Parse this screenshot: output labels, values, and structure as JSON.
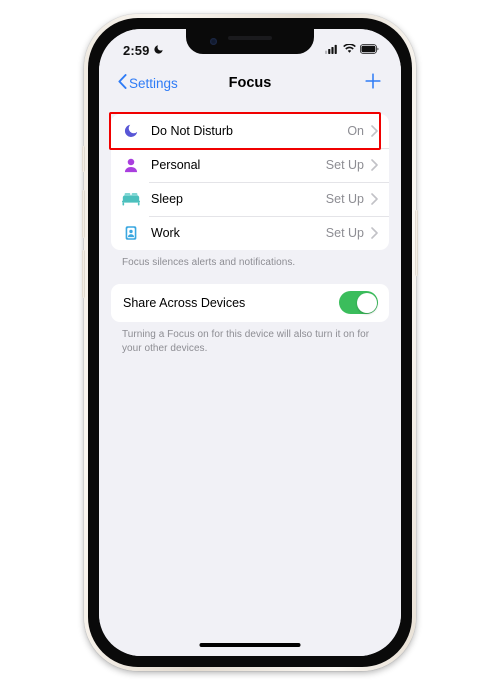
{
  "device": {
    "name": "iphone-13",
    "frame_color": "#efe9e0"
  },
  "status_bar": {
    "time": "2:59",
    "dnd_icon": "crescent-moon-icon",
    "cellular_icon": "cellular-signal-icon",
    "wifi_icon": "wifi-icon",
    "battery_icon": "battery-full-icon"
  },
  "nav": {
    "back_label": "Settings",
    "back_icon": "chevron-left-icon",
    "title": "Focus",
    "add_icon": "plus-icon",
    "accent_color": "#2f7cf6"
  },
  "focus_list": [
    {
      "label": "Do Not Disturb",
      "value": "On",
      "icon": "crescent-moon-icon",
      "icon_color": "#5856d6",
      "highlighted": true
    },
    {
      "label": "Personal",
      "value": "Set Up",
      "icon": "person-icon",
      "icon_color": "#a93ede",
      "highlighted": false
    },
    {
      "label": "Sleep",
      "value": "Set Up",
      "icon": "bed-icon",
      "icon_color": "#4cc0bd",
      "highlighted": false
    },
    {
      "label": "Work",
      "value": "Set Up",
      "icon": "id-badge-icon",
      "icon_color": "#3aa7e0",
      "highlighted": false
    }
  ],
  "focus_footnote": "Focus silences alerts and notifications.",
  "share": {
    "label": "Share Across Devices",
    "toggle_state": "on",
    "toggle_color": "#3bbd5c",
    "footnote": "Turning a Focus on for this device will also turn it on for your other devices."
  },
  "highlight": {
    "color": "#f00000",
    "target": "Do Not Disturb"
  },
  "home_indicator": "home-indicator"
}
